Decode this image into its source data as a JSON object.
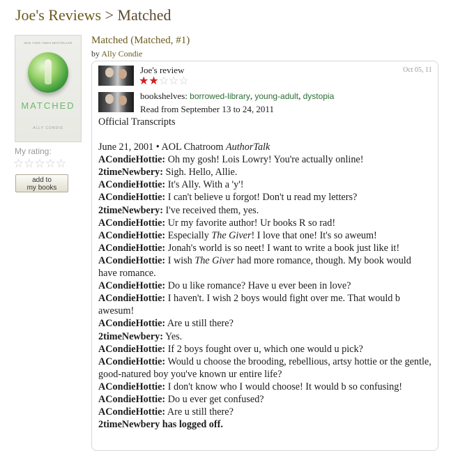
{
  "header": {
    "crumb": "Joe's Reviews",
    "separator": " > ",
    "current": "Matched"
  },
  "book": {
    "cover": {
      "blurb": "NEW YORK TIMES BESTSELLER",
      "title": "MATCHED",
      "author": "ALLY CONDIE"
    },
    "title": "Matched (Matched, #1)",
    "by": "by",
    "author": "Ally Condie"
  },
  "my_rating": {
    "label": "My rating:",
    "value": 0,
    "max": 5
  },
  "add_button": {
    "line1": "add to",
    "line2": "my books"
  },
  "review": {
    "reviewer_label": "Joe's review",
    "date": "Oct 05, 11",
    "rating": 2,
    "max": 5,
    "bookshelves_label": "bookshelves: ",
    "shelves": [
      "borrowed-library",
      "young-adult",
      "dystopia"
    ],
    "shelf_sep": ", ",
    "read_dates": "Read from September 13 to 24, 2011",
    "heading": "Official Transcripts",
    "chat_date": "June 21, 2001 • AOL Chatroom ",
    "chat_venue": "AuthorTalk",
    "lines": [
      {
        "speaker": "ACondieHottie:",
        "text": " Oh my gosh! Lois Lowry! You're actually online!"
      },
      {
        "speaker": "2timeNewbery:",
        "text": " Sigh. Hello, Allie."
      },
      {
        "speaker": "ACondieHottie:",
        "text": " It's Ally. With a 'y'!"
      },
      {
        "speaker": "ACondieHottie:",
        "text": " I can't believe u forgot! Don't u read my letters?"
      },
      {
        "speaker": "2timeNewbery:",
        "text": " I've received them, yes."
      },
      {
        "speaker": "ACondieHottie:",
        "text": " Ur my favorite author! Ur books R so rad!"
      },
      {
        "speaker": "ACondieHottie:",
        "pre": " Especially ",
        "em": "The Giver",
        "text": "! I love that one! It's so aweum!"
      },
      {
        "speaker": "ACondieHottie:",
        "text": " Jonah's world is so neet! I want to write a book just like it!"
      },
      {
        "speaker": "ACondieHottie:",
        "pre": " I wish ",
        "em": "The Giver",
        "text": " had more romance, though. My book would have romance."
      },
      {
        "speaker": "ACondieHottie:",
        "text": " Do u like romance? Have u ever been in love?"
      },
      {
        "speaker": "ACondieHottie:",
        "text": " I haven't. I wish 2 boys would fight over me. That would b awesum!"
      },
      {
        "speaker": "ACondieHottie:",
        "text": " Are u still there?"
      },
      {
        "speaker": "2timeNewbery:",
        "text": " Yes."
      },
      {
        "speaker": "ACondieHottie:",
        "text": " If 2 boys fought over u, which one would u pick?"
      },
      {
        "speaker": "ACondieHottie:",
        "text": " Would u choose the brooding, rebellious, artsy hottie or the gentle, good-natured boy you've known ur entire life?"
      },
      {
        "speaker": "ACondieHottie:",
        "text": " I don't know who I would choose! It would b so confusing!"
      },
      {
        "speaker": "ACondieHottie:",
        "text": " Do u ever get confused?"
      },
      {
        "speaker": "ACondieHottie:",
        "text": " Are u still there?"
      }
    ],
    "closing": "2timeNewbery has logged off."
  },
  "colors": {
    "link_olive": "#6b5b1e",
    "shelf_green": "#2b6e33",
    "star_red": "#d11f1f",
    "star_grey": "#cccccc",
    "header_brown": "#382110"
  }
}
